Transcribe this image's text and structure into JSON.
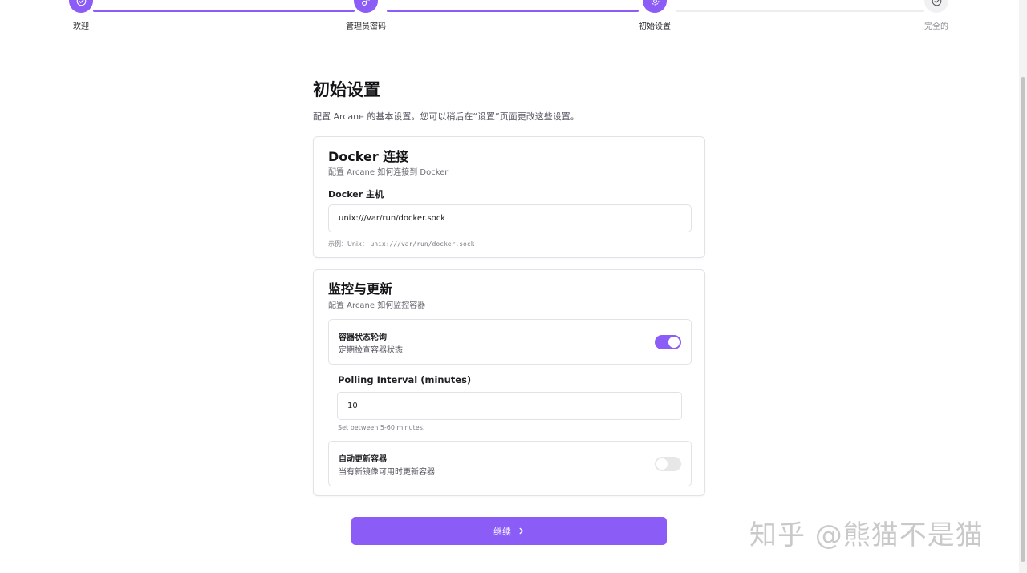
{
  "stepper": {
    "steps": [
      {
        "label": "欢迎",
        "icon": "check-circle-icon",
        "state": "done"
      },
      {
        "label": "管理员密码",
        "icon": "key-icon",
        "state": "done"
      },
      {
        "label": "初始设置",
        "icon": "gear-icon",
        "state": "current"
      },
      {
        "label": "完全的",
        "icon": "check-circle-icon",
        "state": "pending"
      }
    ]
  },
  "page": {
    "title": "初始设置",
    "subtitle": "配置 Arcane 的基本设置。您可以稍后在“设置”页面更改这些设置。"
  },
  "docker": {
    "title": "Docker 连接",
    "description": "配置 Arcane 如何连接到 Docker",
    "host_label": "Docker 主机",
    "host_value": "unix:///var/run/docker.sock",
    "example_prefix": "示例：Unix：",
    "example_value": "unix:///var/run/docker.sock"
  },
  "monitoring": {
    "title": "监控与更新",
    "description": "配置 Arcane 如何监控容器",
    "polling": {
      "title": "容器状态轮询",
      "description": "定期检查容器状态",
      "enabled": true
    },
    "interval_label": "Polling Interval (minutes)",
    "interval_value": "10",
    "interval_hint": "Set between 5-60 minutes.",
    "auto_update": {
      "title": "自动更新容器",
      "description": "当有新镜像可用时更新容器",
      "enabled": false
    }
  },
  "continue_label": "继续",
  "watermark": "知乎 @熊猫不是猫",
  "colors": {
    "accent": "#8b5cf6",
    "border": "#e3e3e7"
  }
}
